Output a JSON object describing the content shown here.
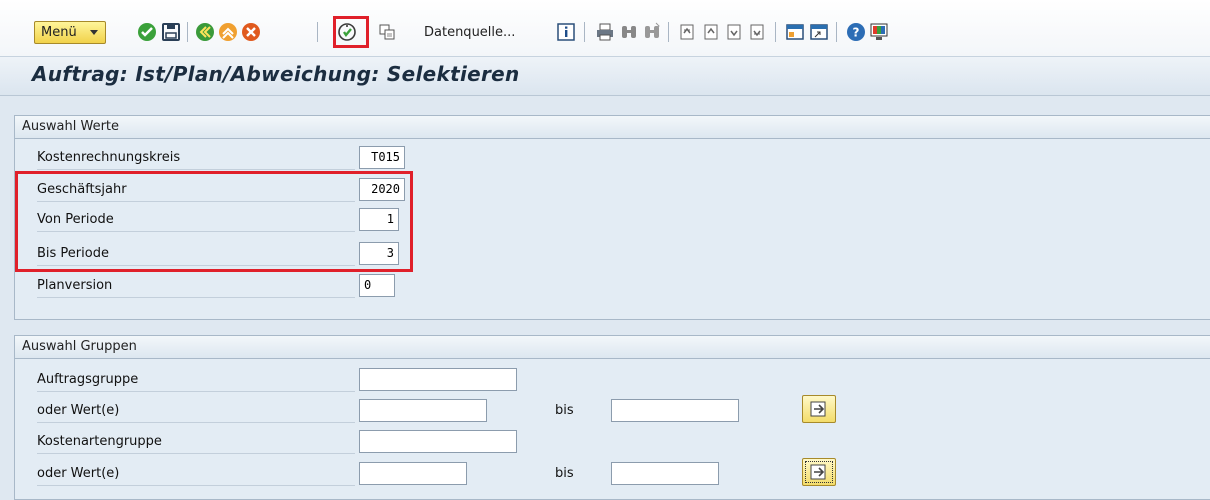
{
  "toolbar": {
    "menu_label": "Menü",
    "datenquelle_label": "Datenquelle...",
    "icons": [
      "check-icon",
      "save-icon",
      "back-icon",
      "exit-icon",
      "cancel-icon",
      "execute-icon",
      "copy-icon",
      "info-icon",
      "print-icon",
      "find-icon",
      "find-next-icon",
      "first-page-icon",
      "previous-page-icon",
      "next-page-icon",
      "last-page-icon",
      "new-session-icon",
      "shortcut-icon",
      "help-icon",
      "layout-icon"
    ],
    "highlight_color": "#e0202a"
  },
  "page_title": "Auftrag: Ist/Plan/Abweichung: Selektieren",
  "auswahl_werte": {
    "header": "Auswahl Werte",
    "fields": [
      {
        "label": "Kostenrechnungskreis",
        "value": "T015"
      },
      {
        "label": "Geschäftsjahr",
        "value": "2020"
      },
      {
        "label": "Von Periode",
        "value": "1"
      },
      {
        "label": "Bis Periode",
        "value": "3"
      },
      {
        "label": "Planversion",
        "value": "0"
      }
    ]
  },
  "auswahl_gruppen": {
    "header": "Auswahl Gruppen",
    "auftragsgruppe_label": "Auftragsgruppe",
    "auftragsgruppe_value": "",
    "auftrag_wert_label": "oder Wert(e)",
    "auftrag_wert_from": "",
    "auftrag_bis_label": "bis",
    "auftrag_wert_to": "",
    "kostenartengruppe_label": "Kostenartengruppe",
    "kostenartengruppe_value": "",
    "kostenart_wert_label": "oder Wert(e)",
    "kostenart_wert_from": "",
    "kostenart_bis_label": "bis",
    "kostenart_wert_to": ""
  }
}
